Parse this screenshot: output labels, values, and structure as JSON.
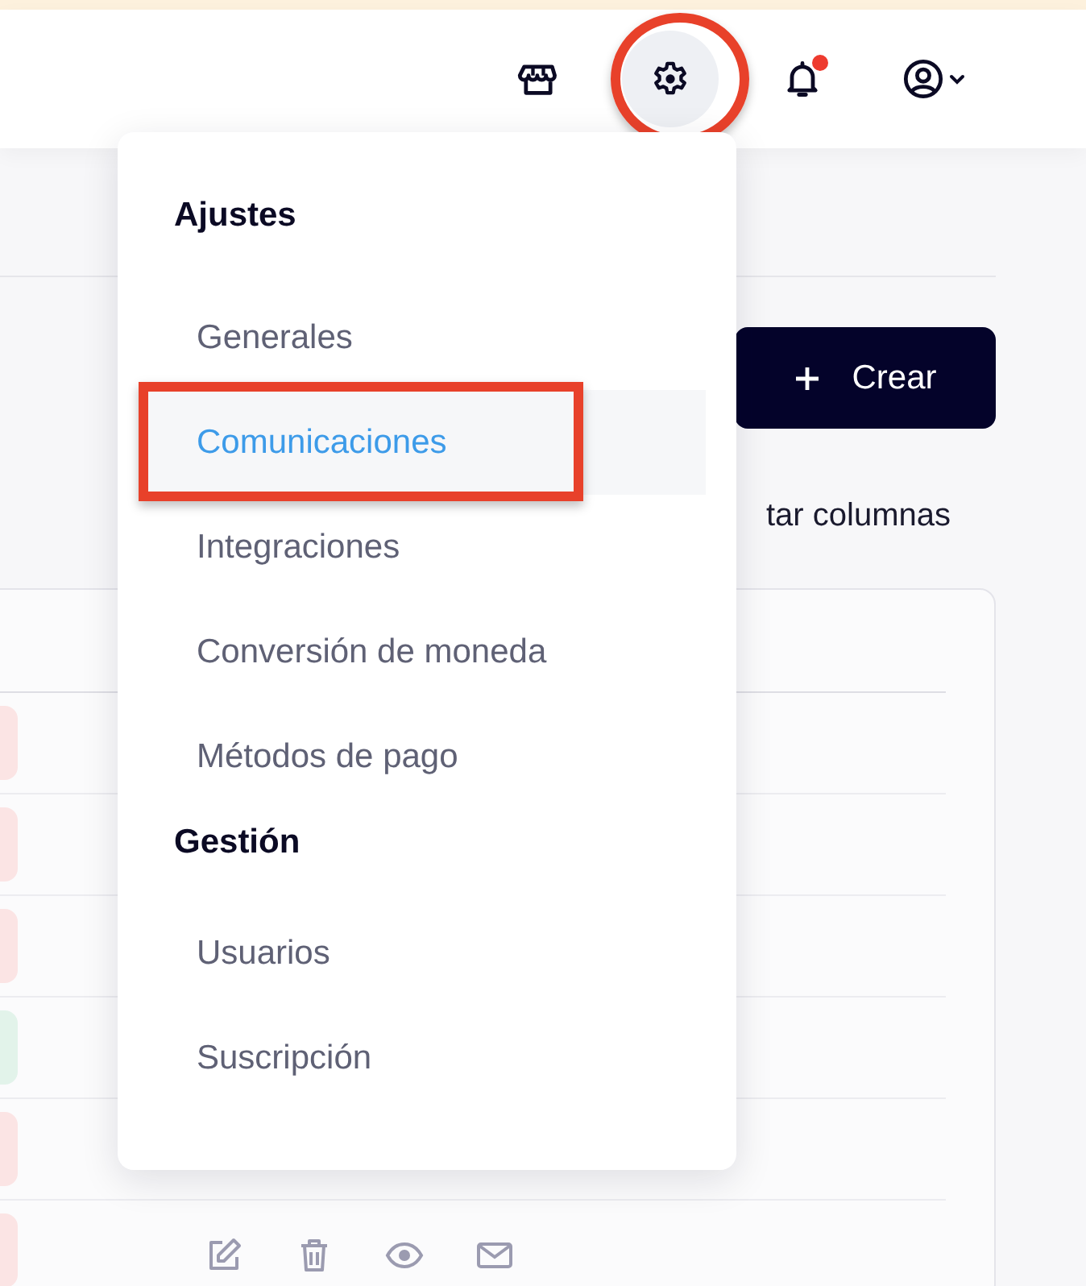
{
  "header": {
    "icons": [
      {
        "kind": "store",
        "highlighted": false,
        "badge": false
      },
      {
        "kind": "settings",
        "highlighted": true,
        "badge": false
      },
      {
        "kind": "bell",
        "highlighted": false,
        "badge": true
      },
      {
        "kind": "account",
        "highlighted": false,
        "badge": false
      }
    ]
  },
  "toolbar": {
    "create_button": "Crear",
    "columns_link": "tar columnas"
  },
  "table": {
    "rows": [
      {
        "color": "#fbe4e4"
      },
      {
        "color": "#fbe4e4"
      },
      {
        "color": "#fbe4e4"
      },
      {
        "color": "#e2f3ea"
      },
      {
        "color": "#fbe4e4"
      },
      {
        "color": "#fbe4e4",
        "actions": [
          {
            "kind": "edit"
          },
          {
            "kind": "delete"
          },
          {
            "kind": "view"
          },
          {
            "kind": "email"
          }
        ]
      }
    ]
  },
  "menu": {
    "sections": [
      {
        "title": "Ajustes",
        "items": [
          {
            "label": "Generales",
            "selected": false,
            "highlighted": false
          },
          {
            "label": "Comunicaciones",
            "selected": true,
            "highlighted": true
          },
          {
            "label": "Integraciones",
            "selected": false,
            "highlighted": false
          },
          {
            "label": "Conversión de moneda",
            "selected": false,
            "highlighted": false
          },
          {
            "label": "Métodos de pago",
            "selected": false,
            "highlighted": false
          }
        ]
      },
      {
        "title": "Gestión",
        "items": [
          {
            "label": "Usuarios",
            "selected": false,
            "highlighted": false
          },
          {
            "label": "Suscripción",
            "selected": false,
            "highlighted": false
          }
        ]
      }
    ]
  }
}
